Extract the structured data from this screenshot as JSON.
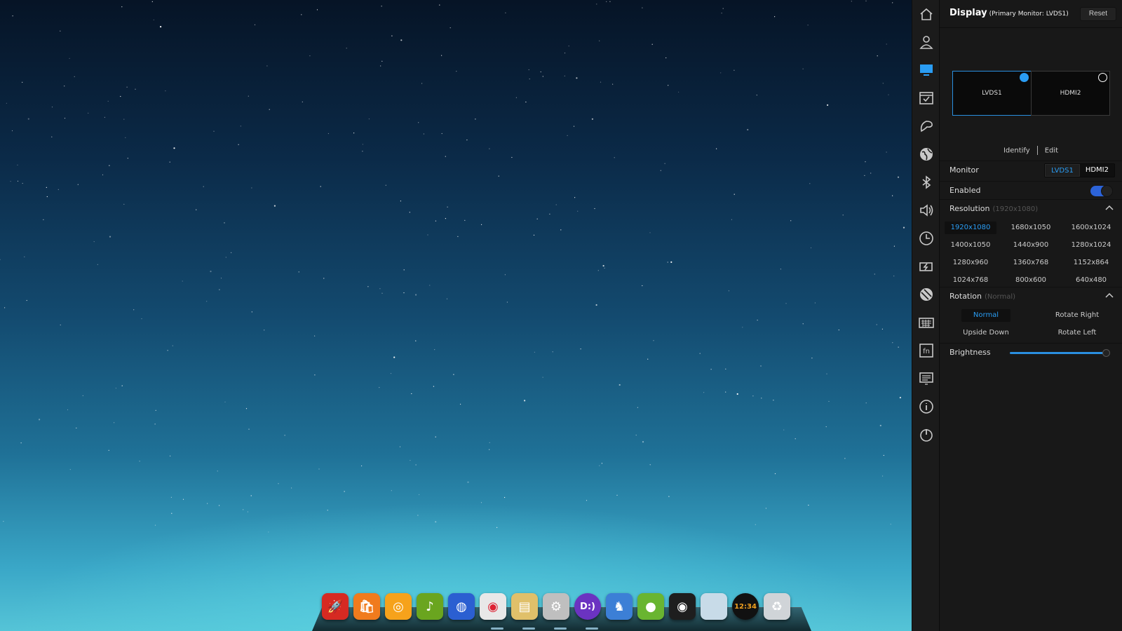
{
  "panel": {
    "title": "Display",
    "subtitle": "(Primary Monitor: LVDS1)",
    "reset_label": "Reset",
    "monitors_preview": [
      {
        "label": "LVDS1",
        "primary": true
      },
      {
        "label": "HDMI2",
        "primary": false
      }
    ],
    "identify_label": "Identify",
    "edit_label": "Edit",
    "monitor_label": "Monitor",
    "monitor_options": [
      "LVDS1",
      "HDMI2"
    ],
    "monitor_selected": "LVDS1",
    "enabled_label": "Enabled",
    "enabled": true,
    "resolution_label": "Resolution",
    "resolution_current": "(1920x1080)",
    "resolutions": [
      "1920x1080",
      "1680x1050",
      "1600x1024",
      "1400x1050",
      "1440x900",
      "1280x1024",
      "1280x960",
      "1360x768",
      "1152x864",
      "1024x768",
      "800x600",
      "640x480"
    ],
    "resolution_selected": "1920x1080",
    "rotation_label": "Rotation",
    "rotation_current": "(Normal)",
    "rotations": [
      "Normal",
      "Rotate Right",
      "Upside Down",
      "Rotate Left"
    ],
    "rotation_selected": "Normal",
    "brightness_label": "Brightness",
    "brightness": 0.95
  },
  "colors": {
    "accent": "#2a9df4",
    "panel_bg": "#181818",
    "toggle_on": "#2c63d8"
  },
  "categories": [
    {
      "name": "home-icon",
      "active": false
    },
    {
      "name": "account-icon",
      "active": false
    },
    {
      "name": "display-icon",
      "active": true
    },
    {
      "name": "default-apps-icon",
      "active": false
    },
    {
      "name": "personalization-icon",
      "active": false
    },
    {
      "name": "network-icon",
      "active": false
    },
    {
      "name": "bluetooth-icon",
      "active": false
    },
    {
      "name": "sound-icon",
      "active": false
    },
    {
      "name": "date-time-icon",
      "active": false
    },
    {
      "name": "power-icon",
      "active": false
    },
    {
      "name": "mouse-touchpad-icon",
      "active": false
    },
    {
      "name": "keyboard-icon",
      "active": false
    },
    {
      "name": "shortcuts-icon",
      "active": false
    },
    {
      "name": "system-info-display-icon",
      "active": false
    },
    {
      "name": "system-info-icon",
      "active": false
    },
    {
      "name": "shutdown-icon",
      "active": false
    }
  ],
  "dock": {
    "apps": [
      {
        "name": "launcher-icon",
        "glyph": "🚀",
        "color": "#d62a22"
      },
      {
        "name": "store-icon",
        "glyph": "🛍",
        "color": "#f07b1d"
      },
      {
        "name": "music-player-icon",
        "glyph": "◎",
        "color": "#f6a21b"
      },
      {
        "name": "music-icon",
        "glyph": "♪",
        "color": "#6aa51f"
      },
      {
        "name": "browser-icon",
        "glyph": "◍",
        "color": "#2b5fd1"
      },
      {
        "name": "chrome-icon",
        "glyph": "◉",
        "color": "#e8e8e8"
      },
      {
        "name": "file-manager-icon",
        "glyph": "▤",
        "color": "#e0c06a"
      },
      {
        "name": "settings-icon",
        "glyph": "⚙",
        "color": "#bfbfbf"
      },
      {
        "name": "media-player-icon",
        "glyph": "D:)",
        "color": "#6b33c1"
      },
      {
        "name": "games-icon",
        "glyph": "♞",
        "color": "#3c7fd6"
      },
      {
        "name": "android-app-icon",
        "glyph": "●",
        "color": "#69b531"
      },
      {
        "name": "camera-icon",
        "glyph": "◉",
        "color": "#1e1e1e"
      },
      {
        "name": "blank-app-icon",
        "glyph": "",
        "color": "#c8dbe8"
      },
      {
        "name": "clock-icon",
        "glyph": "12:34",
        "color": "#111111"
      },
      {
        "name": "trash-icon",
        "glyph": "♻",
        "color": "#d0d4d8"
      }
    ]
  }
}
